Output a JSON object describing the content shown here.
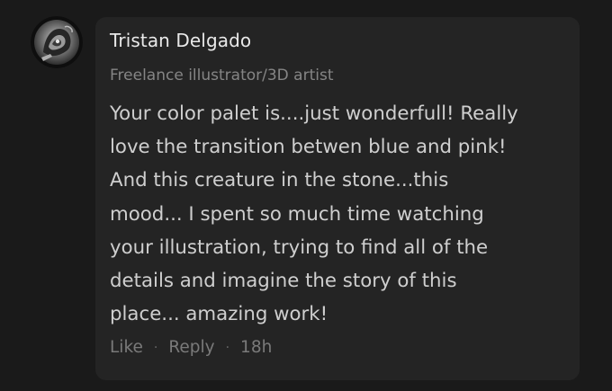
{
  "comment": {
    "author": {
      "name": "Tristan Delgado",
      "headline": "Freelance illustrator/3D artist",
      "avatar_icon": "user-avatar-icon"
    },
    "lines": [
      "Your color palet is....just wonderfull! Really",
      "love the transition betwen blue and pink!",
      "And this creature in the stone...this",
      "mood... I spent so much time watching",
      "your illustration, trying to find all of the",
      "details and imagine the story of this",
      "place... amazing work!"
    ],
    "actions": {
      "like": "Like",
      "separator": "·",
      "reply": "Reply",
      "time": "18h"
    }
  },
  "colors": {
    "page_background": "#1a1a1a",
    "bubble_background": "#242424",
    "author_text": "#e9e9e9",
    "headline_text": "#858585",
    "body_text": "#cfcfcf",
    "action_text": "#7a7a7a"
  }
}
